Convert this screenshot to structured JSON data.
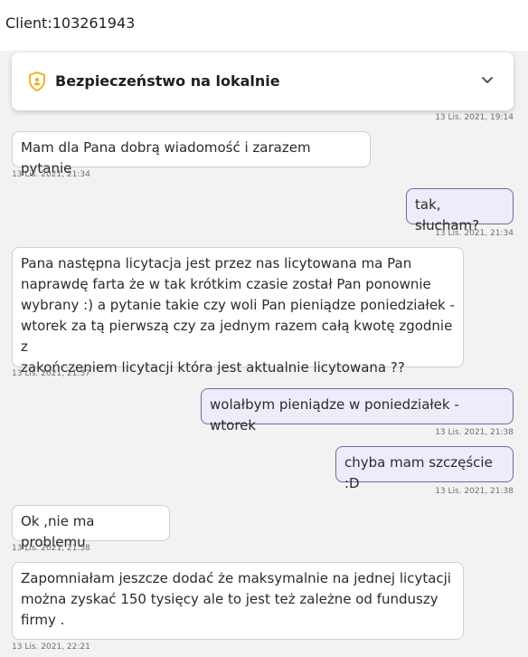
{
  "header": {
    "client_label": "Client:103261943"
  },
  "security_card": {
    "title": "Bezpieczeństwo na lokalnie",
    "icon": "shield-user-icon",
    "accent": "#f0b429"
  },
  "card_timestamp": "13 Lis. 2021, 19:14",
  "messages": [
    {
      "direction": "incoming",
      "text": "Mam dla Pana dobrą wiadomość i zarazem pytanie",
      "time": "13 Lis. 2021, 21:34"
    },
    {
      "direction": "outgoing",
      "text": "tak, słucham?",
      "time": "13 Lis. 2021, 21:34"
    },
    {
      "direction": "incoming",
      "text": "Pana następna licytacja jest przez nas licytowana ma Pan\nnaprawdę farta że w tak krótkim czasie został Pan ponownie\nwybrany :) a pytanie takie czy woli Pan pieniądze poniedziałek -\nwtorek za tą pierwszą czy za jednym razem całą kwotę zgodnie z\nzakończeniem licytacji która jest aktualnie licytowana ??",
      "time": "13 Lis. 2021, 21:37"
    },
    {
      "direction": "outgoing",
      "text": "wolałbym pieniądze w poniedziałek - wtorek",
      "time": "13 Lis. 2021, 21:38"
    },
    {
      "direction": "outgoing",
      "text": "chyba mam szczęście :D",
      "time": "13 Lis. 2021, 21:38"
    },
    {
      "direction": "incoming",
      "text": "Ok ,nie ma problemu",
      "time": "13 Lis. 2021, 21:38"
    },
    {
      "direction": "incoming",
      "text": "Zapomniałam jeszcze dodać że maksymalnie na jednej licytacji\nmożna zyskać 150 tysięcy ale to jest też zależne od funduszy\nfirmy .",
      "time": "13 Lis. 2021, 22:21"
    }
  ]
}
